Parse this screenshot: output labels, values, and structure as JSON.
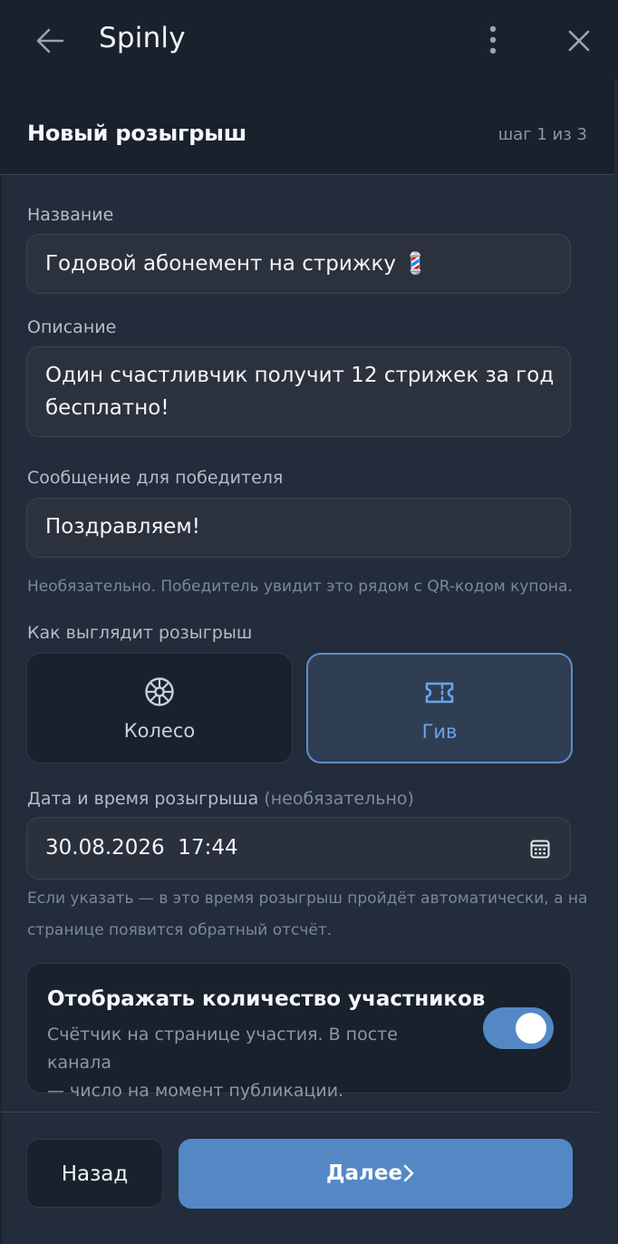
{
  "app": {
    "title": "Spinly"
  },
  "header": {
    "title": "Новый розыгрыш",
    "step": "шаг 1 из 3"
  },
  "form": {
    "name": {
      "label": "Название",
      "value": "Годовой абонемент на стрижку 💈"
    },
    "description": {
      "label": "Описание",
      "line1": "Один счастливчик получит 12 стрижек за год",
      "line2": "бесплатно!"
    },
    "winner_message": {
      "label": "Сообщение для победителя",
      "value": "Поздравляем!",
      "hint": "Необязательно. Победитель увидит это рядом с QR-кодом купона."
    },
    "appearance": {
      "label": "Как выглядит розыгрыш",
      "options": [
        {
          "label": "Колесо",
          "icon": "wheel-icon",
          "selected": false
        },
        {
          "label": "Гив",
          "icon": "ticket-icon",
          "selected": true
        }
      ]
    },
    "datetime": {
      "label": "Дата и время розыгрыша",
      "label_optional": "(необязательно)",
      "value": "30.08.2026  17:44",
      "hint_line1": "Если указать — в это время розыгрыш пройдёт автоматически, а на",
      "hint_line2": "странице появится обратный отсчёт."
    },
    "participants_toggle": {
      "title": "Отображать количество участников",
      "desc_line1": "Счётчик на странице участия. В посте канала",
      "desc_line2": "— число на момент публикации.",
      "enabled": true
    }
  },
  "footer": {
    "back_label": "Назад",
    "next_label": "Далее"
  },
  "colors": {
    "accent": "#5488c5",
    "background": "#222c3a",
    "header": "#18212c",
    "field": "#2b323d",
    "selected_accent_border": "#5d8fc8",
    "selected_text": "#6aa3e6"
  }
}
